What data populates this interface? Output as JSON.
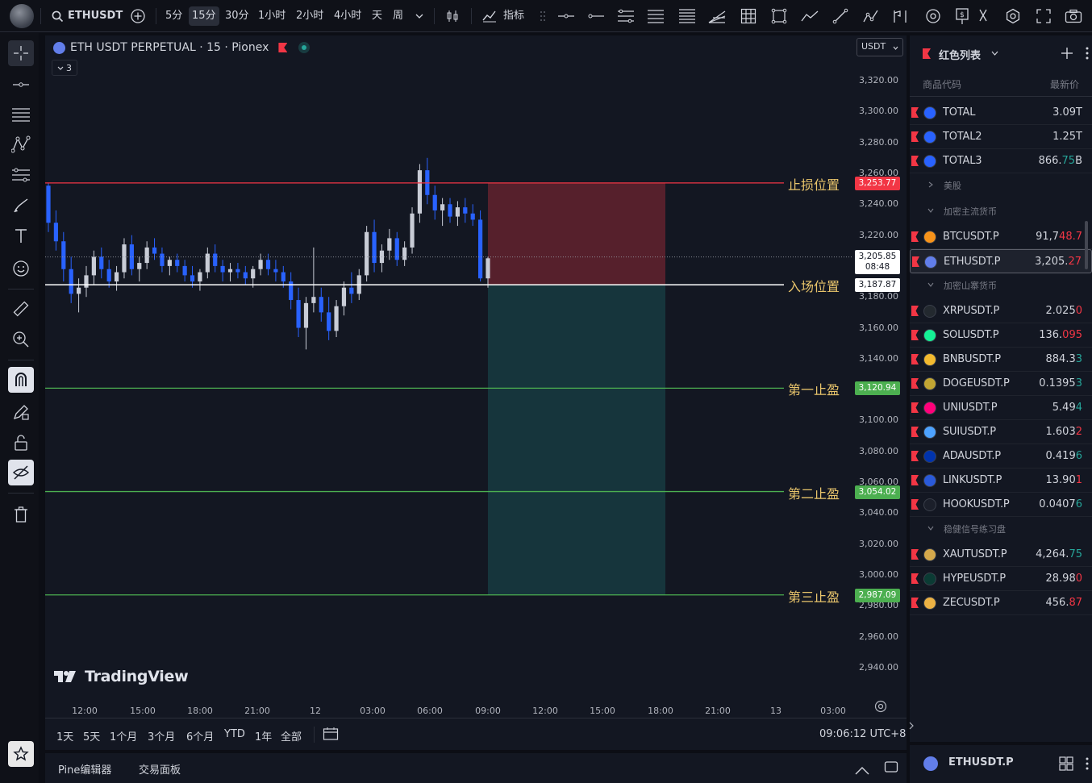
{
  "topbar": {
    "symbol": "ETHUSDT",
    "intervals": [
      "5分",
      "15分",
      "30分",
      "1小时",
      "2小时",
      "4小时",
      "天",
      "周"
    ],
    "active_interval": "15分",
    "indicators_label": "指标"
  },
  "chart": {
    "title": "ETH USDT PERPETUAL · 15 · Pionex",
    "currency": "USDT",
    "collapse_count": "3",
    "watermark": "TradingView",
    "y_ticks": [
      "3,320.00",
      "3,300.00",
      "3,280.00",
      "3,260.00",
      "3,240.00",
      "3,220.00",
      "3,180.00",
      "3,160.00",
      "3,140.00",
      "3,100.00",
      "3,080.00",
      "3,060.00",
      "3,040.00",
      "3,020.00",
      "3,000.00",
      "2,980.00",
      "2,960.00",
      "2,940.00"
    ],
    "x_ticks": [
      "12:00",
      "15:00",
      "18:00",
      "21:00",
      "12",
      "03:00",
      "06:00",
      "09:00",
      "12:00",
      "15:00",
      "18:00",
      "21:00",
      "13",
      "03:00"
    ],
    "last_price": "3,205.85",
    "countdown": "08:48",
    "levels": [
      {
        "label": "止损位置",
        "price": "3,253.77",
        "color": "#f23645"
      },
      {
        "label": "入场位置",
        "price": "3,187.87",
        "color": "#ffffff"
      },
      {
        "label": "第一止盈",
        "price": "3,120.94",
        "color": "#4caf50"
      },
      {
        "label": "第二止盈",
        "price": "3,054.02",
        "color": "#4caf50"
      },
      {
        "label": "第三止盈",
        "price": "2,987.09",
        "color": "#4caf50"
      }
    ]
  },
  "chart_data": {
    "type": "candlestick",
    "title": "ETH USDT PERPETUAL · 15 · Pionex",
    "ylim": [
      2930,
      3330
    ],
    "x_range": [
      "12:00",
      "03:00 (13)"
    ],
    "candles_ohlc": [
      [
        3252,
        3254,
        3222,
        3228
      ],
      [
        3228,
        3236,
        3210,
        3216
      ],
      [
        3216,
        3222,
        3190,
        3198
      ],
      [
        3198,
        3206,
        3176,
        3182
      ],
      [
        3182,
        3192,
        3170,
        3186
      ],
      [
        3186,
        3200,
        3180,
        3194
      ],
      [
        3194,
        3210,
        3188,
        3206
      ],
      [
        3206,
        3212,
        3192,
        3198
      ],
      [
        3198,
        3204,
        3186,
        3190
      ],
      [
        3190,
        3200,
        3184,
        3196
      ],
      [
        3196,
        3218,
        3192,
        3214
      ],
      [
        3214,
        3220,
        3194,
        3198
      ],
      [
        3198,
        3206,
        3190,
        3202
      ],
      [
        3202,
        3216,
        3198,
        3212
      ],
      [
        3212,
        3218,
        3204,
        3208
      ],
      [
        3208,
        3212,
        3196,
        3200
      ],
      [
        3200,
        3206,
        3194,
        3204
      ],
      [
        3204,
        3208,
        3196,
        3200
      ],
      [
        3200,
        3204,
        3190,
        3194
      ],
      [
        3194,
        3200,
        3186,
        3190
      ],
      [
        3190,
        3198,
        3184,
        3196
      ],
      [
        3196,
        3212,
        3192,
        3208
      ],
      [
        3208,
        3214,
        3196,
        3200
      ],
      [
        3200,
        3204,
        3190,
        3196
      ],
      [
        3196,
        3202,
        3190,
        3198
      ],
      [
        3198,
        3202,
        3192,
        3196
      ],
      [
        3196,
        3200,
        3188,
        3192
      ],
      [
        3192,
        3200,
        3186,
        3198
      ],
      [
        3198,
        3208,
        3194,
        3204
      ],
      [
        3204,
        3208,
        3194,
        3198
      ],
      [
        3198,
        3204,
        3190,
        3196
      ],
      [
        3196,
        3200,
        3186,
        3190
      ],
      [
        3190,
        3196,
        3172,
        3178
      ],
      [
        3178,
        3186,
        3154,
        3160
      ],
      [
        3160,
        3180,
        3146,
        3176
      ],
      [
        3176,
        3212,
        3170,
        3180
      ],
      [
        3180,
        3186,
        3164,
        3170
      ],
      [
        3170,
        3180,
        3152,
        3158
      ],
      [
        3158,
        3178,
        3154,
        3174
      ],
      [
        3174,
        3190,
        3168,
        3186
      ],
      [
        3186,
        3196,
        3176,
        3182
      ],
      [
        3182,
        3198,
        3178,
        3194
      ],
      [
        3194,
        3226,
        3190,
        3222
      ],
      [
        3222,
        3230,
        3196,
        3202
      ],
      [
        3202,
        3214,
        3196,
        3210
      ],
      [
        3210,
        3224,
        3204,
        3218
      ],
      [
        3218,
        3222,
        3200,
        3204
      ],
      [
        3204,
        3216,
        3200,
        3212
      ],
      [
        3212,
        3238,
        3208,
        3234
      ],
      [
        3234,
        3266,
        3228,
        3262
      ],
      [
        3262,
        3270,
        3240,
        3246
      ],
      [
        3246,
        3252,
        3230,
        3236
      ],
      [
        3236,
        3244,
        3226,
        3240
      ],
      [
        3240,
        3244,
        3228,
        3232
      ],
      [
        3232,
        3242,
        3226,
        3238
      ],
      [
        3238,
        3244,
        3228,
        3234
      ],
      [
        3234,
        3240,
        3226,
        3230
      ],
      [
        3230,
        3236,
        3190,
        3192
      ],
      [
        3192,
        3206,
        3186,
        3205
      ]
    ]
  },
  "bottombar": {
    "ranges": [
      "1天",
      "5天",
      "1个月",
      "3个月",
      "6个月",
      "YTD",
      "1年",
      "全部"
    ],
    "clock": "09:06:12 UTC+8"
  },
  "panelbar": {
    "tabs": [
      "Pine编辑器",
      "交易面板"
    ]
  },
  "watchlist": {
    "title": "红色列表",
    "col_symbol": "商品代码",
    "col_price": "最新价",
    "rows": [
      {
        "type": "item",
        "sym": "TOTAL",
        "price": "3.09",
        "suffix": "T",
        "hl": "",
        "coin": "#2962ff"
      },
      {
        "type": "item",
        "sym": "TOTAL2",
        "price": "1.25",
        "suffix": "T",
        "hl": "",
        "coin": "#2962ff"
      },
      {
        "type": "item",
        "sym": "TOTAL3",
        "price": "866.",
        "hl": "75",
        "suffix": "B",
        "hlc": "#26a69a",
        "coin": "#2962ff"
      },
      {
        "type": "section",
        "label": "美股",
        "collapsed": true
      },
      {
        "type": "section",
        "label": "加密主流货币",
        "collapsed": false
      },
      {
        "type": "item",
        "sym": "BTCUSDT.P",
        "price": "91,7",
        "hl": "48.7",
        "hlc": "#f23645",
        "coin": "#f7931a"
      },
      {
        "type": "item",
        "sym": "ETHUSDT.P",
        "price": "3,205.",
        "hl": "27",
        "hlc": "#f23645",
        "coin": "#627eea",
        "selected": true
      },
      {
        "type": "section",
        "label": "加密山寨货币",
        "collapsed": false
      },
      {
        "type": "item",
        "sym": "XRPUSDT.P",
        "price": "2.025",
        "hl": "0",
        "hlc": "#f23645",
        "coin": "#23292f"
      },
      {
        "type": "item",
        "sym": "SOLUSDT.P",
        "price": "136.",
        "hl": "095",
        "hlc": "#f23645",
        "coin": "#14f195"
      },
      {
        "type": "item",
        "sym": "BNBUSDT.P",
        "price": "884.3",
        "hl": "3",
        "hlc": "#26a69a",
        "coin": "#f3ba2f"
      },
      {
        "type": "item",
        "sym": "DOGEUSDT.P",
        "price": "0.1395",
        "hl": "3",
        "hlc": "#26a69a",
        "coin": "#c2a633"
      },
      {
        "type": "item",
        "sym": "UNIUSDT.P",
        "price": "5.49",
        "hl": "4",
        "hlc": "#26a69a",
        "coin": "#ff007a"
      },
      {
        "type": "item",
        "sym": "SUIUSDT.P",
        "price": "1.603",
        "hl": "2",
        "hlc": "#f23645",
        "coin": "#4da2ff"
      },
      {
        "type": "item",
        "sym": "ADAUSDT.P",
        "price": "0.419",
        "hl": "6",
        "hlc": "#26a69a",
        "coin": "#0033ad"
      },
      {
        "type": "item",
        "sym": "LINKUSDT.P",
        "price": "13.90",
        "hl": "1",
        "hlc": "#f23645",
        "coin": "#2a5ada"
      },
      {
        "type": "item",
        "sym": "HOOKUSDT.P",
        "price": "0.0407",
        "hl": "6",
        "hlc": "#26a69a",
        "coin": "#1b1f2a"
      },
      {
        "type": "section",
        "label": "稳健信号练习盘",
        "collapsed": false
      },
      {
        "type": "item",
        "sym": "XAUTUSDT.P",
        "price": "4,264.",
        "hl": "75",
        "hlc": "#26a69a",
        "coin": "#d4a84b"
      },
      {
        "type": "item",
        "sym": "HYPEUSDT.P",
        "price": "28.98",
        "hl": "0",
        "hlc": "#f23645",
        "coin": "#0b3b34"
      },
      {
        "type": "item",
        "sym": "ZECUSDT.P",
        "price": "456.",
        "hl": "87",
        "hlc": "#f23645",
        "coin": "#ecb244"
      }
    ],
    "footer_symbol": "ETHUSDT.P"
  }
}
